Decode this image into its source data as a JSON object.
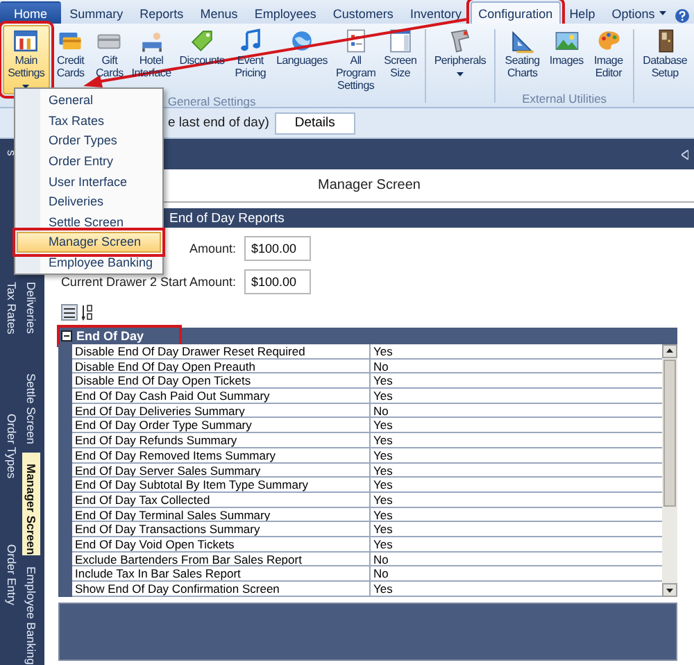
{
  "menu_tabs": [
    {
      "label": "Home",
      "kind": "app",
      "selected": false,
      "annotated": false
    },
    {
      "label": "Summary",
      "kind": "tab",
      "selected": false,
      "annotated": false
    },
    {
      "label": "Reports",
      "kind": "tab",
      "selected": false,
      "annotated": false
    },
    {
      "label": "Menus",
      "kind": "tab",
      "selected": false,
      "annotated": false
    },
    {
      "label": "Employees",
      "kind": "tab",
      "selected": false,
      "annotated": false
    },
    {
      "label": "Customers",
      "kind": "tab",
      "selected": false,
      "annotated": false
    },
    {
      "label": "Inventory",
      "kind": "tab",
      "selected": false,
      "annotated": false
    },
    {
      "label": "Configuration",
      "kind": "tab",
      "selected": true,
      "annotated": true
    },
    {
      "label": "Help",
      "kind": "tab",
      "selected": false,
      "annotated": false
    },
    {
      "label": "Options",
      "kind": "dropdown",
      "selected": false,
      "annotated": false
    }
  ],
  "ribbon": {
    "groups": [
      {
        "label": "General Settings",
        "buttons": [
          {
            "label": "Main Settings",
            "dropdown": true,
            "active": true,
            "annotated": true
          },
          {
            "label": "Credit Cards",
            "dropdown": false,
            "active": false,
            "annotated": false
          },
          {
            "label": "Gift Cards",
            "dropdown": false,
            "active": false,
            "annotated": false
          },
          {
            "label": "Hotel Interface",
            "dropdown": false,
            "active": false,
            "annotated": false
          },
          {
            "label": "Discounts",
            "dropdown": false,
            "active": false,
            "annotated": false
          },
          {
            "label": "Event Pricing",
            "dropdown": false,
            "active": false,
            "annotated": false
          },
          {
            "label": "Languages",
            "dropdown": false,
            "active": false,
            "annotated": false
          },
          {
            "label": "All Program Settings",
            "dropdown": false,
            "active": false,
            "annotated": false
          },
          {
            "label": "Screen Size",
            "dropdown": false,
            "active": false,
            "annotated": false
          }
        ]
      },
      {
        "buttons": [
          {
            "label": "Peripherals",
            "dropdown": true,
            "active": false,
            "annotated": false
          }
        ]
      },
      {
        "label": "External Utilities",
        "buttons": [
          {
            "label": "Seating Charts",
            "dropdown": false,
            "active": false,
            "annotated": false
          },
          {
            "label": "Images",
            "dropdown": false,
            "active": false,
            "annotated": false
          },
          {
            "label": "Image Editor",
            "dropdown": false,
            "active": false,
            "annotated": false
          }
        ]
      },
      {
        "buttons": [
          {
            "label": "Database Setup",
            "dropdown": false,
            "active": false,
            "annotated": false
          }
        ]
      }
    ]
  },
  "settings_menu": {
    "items": [
      {
        "label": "General",
        "selected": false,
        "annotated": false
      },
      {
        "label": "Tax Rates",
        "selected": false,
        "annotated": false
      },
      {
        "label": "Order Types",
        "selected": false,
        "annotated": false
      },
      {
        "label": "Order Entry",
        "selected": false,
        "annotated": false
      },
      {
        "label": "User Interface",
        "selected": false,
        "annotated": false
      },
      {
        "label": "Deliveries",
        "selected": false,
        "annotated": false
      },
      {
        "label": "Settle Screen",
        "selected": false,
        "annotated": false
      },
      {
        "label": "Manager Screen",
        "selected": true,
        "annotated": true
      },
      {
        "label": "Employee Banking",
        "selected": false,
        "annotated": false
      }
    ]
  },
  "info_bar": {
    "text": "e last end of day)",
    "button": "Details"
  },
  "side_tabs": {
    "columns": [
      [
        {
          "label": "s",
          "selected": false
        },
        {
          "label": "Tax Rates",
          "selected": false
        },
        {
          "label": "Order Types",
          "selected": false
        },
        {
          "label": "Order Entry",
          "selected": false
        }
      ],
      [
        {
          "label": "Deliveries",
          "selected": false
        },
        {
          "label": "Settle Screen",
          "selected": false
        },
        {
          "label": "Manager Screen",
          "selected": true
        },
        {
          "label": "Employee Banking",
          "selected": false
        }
      ]
    ]
  },
  "panel": {
    "title": "Manager Screen",
    "section": "End of Day Reports",
    "fields": [
      {
        "label": "Amount:",
        "value": "$100.00"
      },
      {
        "label": "Current Drawer 2 Start Amount:",
        "value": "$100.00"
      }
    ],
    "property_grid": {
      "category": {
        "label": "End Of Day",
        "expanded": true,
        "annotated": true
      },
      "rows": [
        {
          "name": "Disable End Of Day Drawer Reset Required",
          "value": "Yes"
        },
        {
          "name": "Disable End Of Day Open Preauth",
          "value": "No"
        },
        {
          "name": "Disable End Of Day Open Tickets",
          "value": "Yes"
        },
        {
          "name": "End Of Day Cash Paid Out Summary",
          "value": "Yes"
        },
        {
          "name": "End Of Day Deliveries Summary",
          "value": "No"
        },
        {
          "name": "End Of Day Order Type Summary",
          "value": "Yes"
        },
        {
          "name": "End Of Day Refunds Summary",
          "value": "Yes"
        },
        {
          "name": "End Of Day Removed Items Summary",
          "value": "Yes"
        },
        {
          "name": "End Of Day Server Sales Summary",
          "value": "Yes"
        },
        {
          "name": "End Of Day Subtotal By Item Type Summary",
          "value": "Yes"
        },
        {
          "name": "End Of Day Tax Collected",
          "value": "Yes"
        },
        {
          "name": "End Of Day Terminal Sales Summary",
          "value": "Yes"
        },
        {
          "name": "End Of Day Transactions Summary",
          "value": "Yes"
        },
        {
          "name": "End Of Day Void Open Tickets",
          "value": "Yes"
        },
        {
          "name": "Exclude Bartenders From Bar Sales Report",
          "value": "No"
        },
        {
          "name": "Include Tax In Bar Sales Report",
          "value": "No"
        },
        {
          "name": "Show End Of Day Confirmation Screen",
          "value": "Yes"
        }
      ]
    }
  }
}
